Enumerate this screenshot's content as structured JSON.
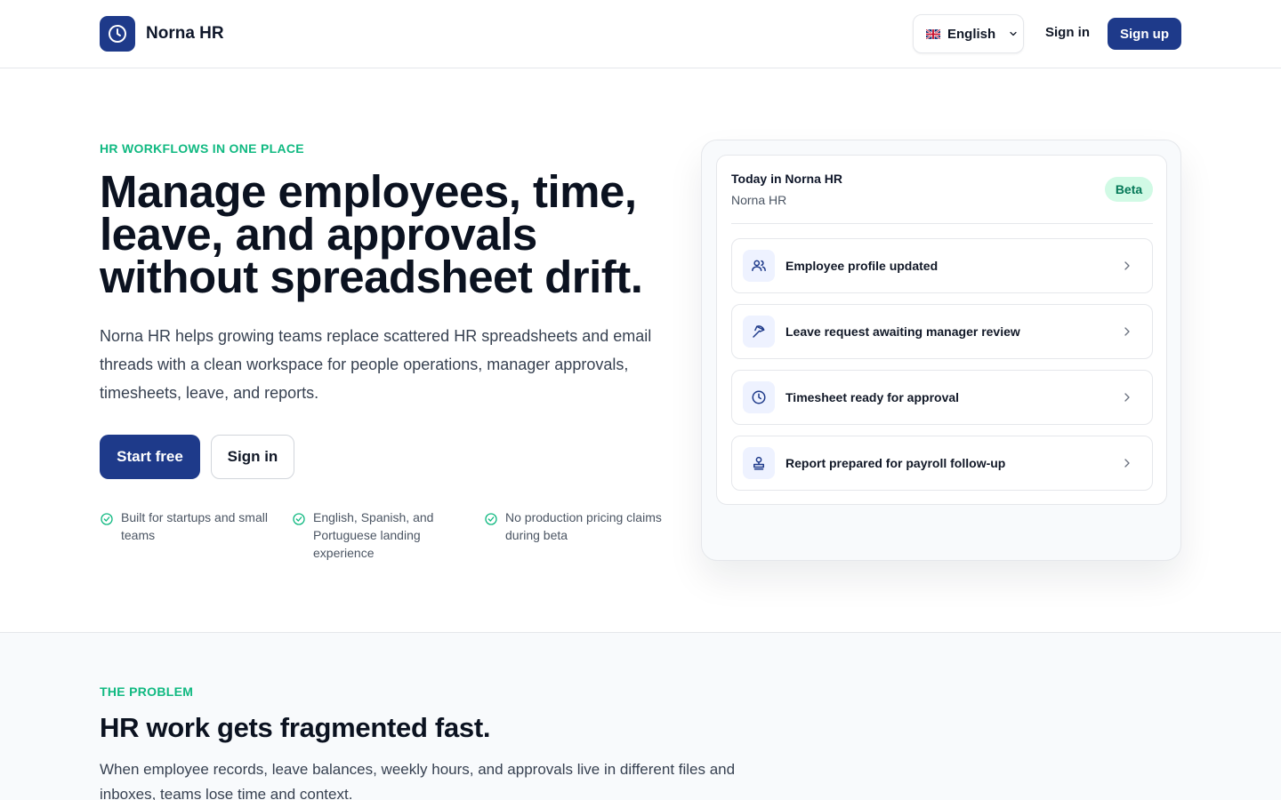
{
  "header": {
    "brand_name": "Norna HR",
    "language_label": "English",
    "signin_label": "Sign in",
    "signup_label": "Sign up"
  },
  "hero": {
    "eyebrow": "HR workflows in one place",
    "title": "Manage employees, time, leave, and approvals without spreadsheet drift.",
    "subtitle": "Norna HR helps growing teams replace scattered HR spreadsheets and email threads with a clean workspace for people operations, manager approvals, timesheets, leave, and reports.",
    "primary_cta": "Start free",
    "secondary_cta": "Sign in",
    "features": [
      "Built for startups and small teams",
      "English, Spanish, and Portuguese landing experience",
      "No production pricing claims during beta"
    ]
  },
  "preview_card": {
    "title": "Today in Norna HR",
    "subtitle": "Norna HR",
    "badge": "Beta",
    "items": [
      {
        "label": "Employee profile updated",
        "icon": "users-icon"
      },
      {
        "label": "Leave request awaiting manager review",
        "icon": "beach-umbrella-icon"
      },
      {
        "label": "Timesheet ready for approval",
        "icon": "clock-icon"
      },
      {
        "label": "Report prepared for payroll follow-up",
        "icon": "stamp-icon"
      }
    ]
  },
  "problem": {
    "eyebrow": "The problem",
    "title": "HR work gets fragmented fast.",
    "text": "When employee records, leave balances, weekly hours, and approvals live in different files and inboxes, teams lose time and context."
  },
  "colors": {
    "brand": "#1e3a8a",
    "accent": "#10b981",
    "badge_bg": "#d1fae5"
  }
}
